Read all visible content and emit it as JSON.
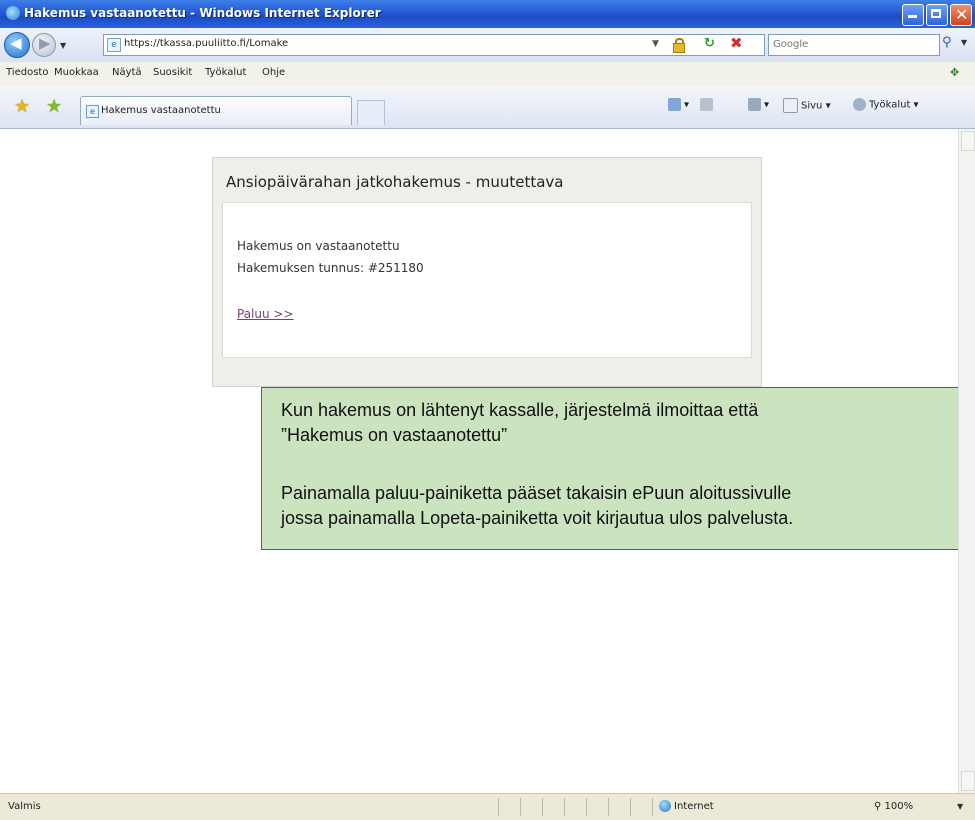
{
  "window": {
    "title": "Hakemus vastaanotettu - Windows Internet Explorer"
  },
  "address_bar": {
    "url": "https://tkassa.puuliitto.fi/Lomake",
    "search_placeholder": "Google"
  },
  "menu": {
    "items": [
      "Tiedosto",
      "Muokkaa",
      "Näytä",
      "Suosikit",
      "Työkalut",
      "Ohje"
    ]
  },
  "tab": {
    "label": "Hakemus vastaanotettu"
  },
  "command_bar": {
    "page_label": "Sivu",
    "tools_label": "Työkalut"
  },
  "page": {
    "panel_title": "Ansiopäivärahan jatkohakemus - muutettava",
    "received_text": "Hakemus on vastaanotettu",
    "id_text": "Hakemuksen tunnus: #251180",
    "back_link": "Paluu >>"
  },
  "callout": {
    "line1": "Kun hakemus on lähtenyt kassalle, järjestelmä ilmoittaa että",
    "line2": "”Hakemus on vastaanotettu”",
    "line3": "Painamalla paluu-painiketta pääset takaisin ePuun aloitussivulle",
    "line4": "jossa painamalla Lopeta-painiketta voit kirjautua ulos palvelusta."
  },
  "status_bar": {
    "status_text": "Valmis",
    "zone": "Internet",
    "zoom": "100%"
  },
  "colors": {
    "callout_bg": "#cce3c0",
    "link": "#7a3d78",
    "titlebar": "#2559d4"
  }
}
